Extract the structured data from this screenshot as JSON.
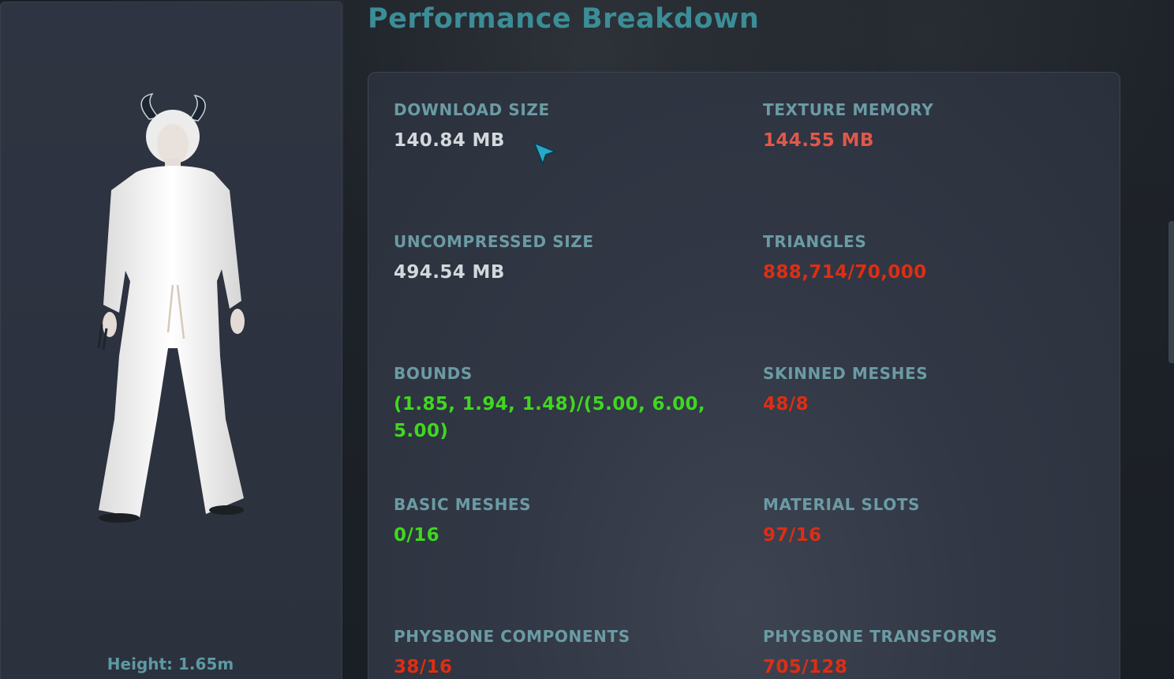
{
  "page": {
    "title": "Performance Breakdown"
  },
  "avatar": {
    "height_label": "Height: 1.65m"
  },
  "stats": {
    "download_size": {
      "label": "DOWNLOAD SIZE",
      "value": "140.84 MB",
      "status": "neutral"
    },
    "texture_memory": {
      "label": "TEXTURE MEMORY",
      "value": "144.55 MB",
      "status": "warn"
    },
    "uncompressed_size": {
      "label": "UNCOMPRESSED SIZE",
      "value": "494.54 MB",
      "status": "neutral"
    },
    "triangles": {
      "label": "TRIANGLES",
      "value": "888,714/70,000",
      "status": "bad"
    },
    "bounds": {
      "label": "BOUNDS",
      "value": "(1.85, 1.94, 1.48)/(5.00, 6.00, 5.00)",
      "status": "good"
    },
    "skinned_meshes": {
      "label": "SKINNED MESHES",
      "value": "48/8",
      "status": "bad"
    },
    "basic_meshes": {
      "label": "BASIC MESHES",
      "value": "0/16",
      "status": "good"
    },
    "material_slots": {
      "label": "MATERIAL SLOTS",
      "value": "97/16",
      "status": "bad"
    },
    "physbone_components": {
      "label": "PHYSBONE COMPONENTS",
      "value": "38/16",
      "status": "bad"
    },
    "physbone_transforms": {
      "label": "PHYSBONE TRANSFORMS",
      "value": "705/128",
      "status": "bad"
    }
  },
  "colors": {
    "title": "#3b8d97",
    "label": "#6b9ba4",
    "neutral": "#d4d8dd",
    "warn": "#e0584a",
    "bad": "#dd2e14",
    "good": "#3fd81f"
  },
  "icons": {
    "cursor": "pointer-cursor-icon",
    "avatar": "avatar-preview"
  }
}
